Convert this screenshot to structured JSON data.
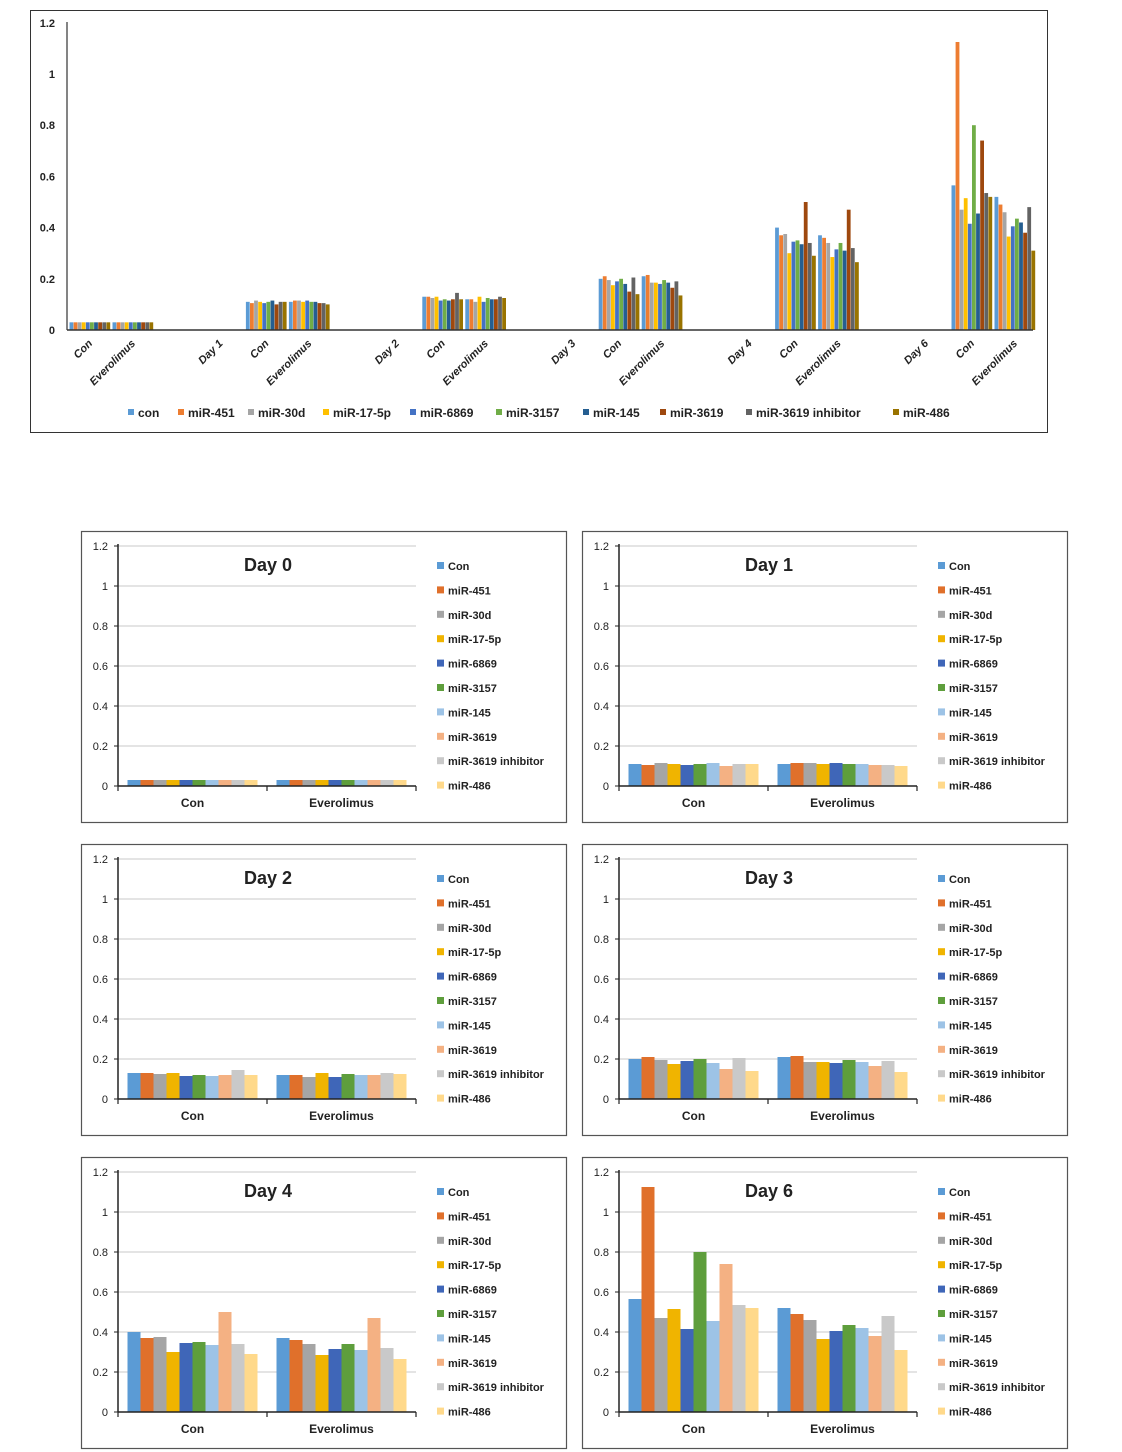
{
  "overview_legend_colors": [
    "#5B9BD5",
    "#ED7D31",
    "#A5A5A5",
    "#FFC000",
    "#4472C4",
    "#70AD47",
    "#255E91",
    "#9E480E",
    "#636363",
    "#997300"
  ],
  "panel_legend_colors": [
    "#5B9BD5",
    "#E0702B",
    "#A5A5A5",
    "#F0B400",
    "#3F66B8",
    "#5E9E3C",
    "#9DC3E6",
    "#F4B183",
    "#C9C9C9",
    "#FFD98B"
  ],
  "chart_data": [
    {
      "type": "bar",
      "yticks": [
        "0",
        "0.2",
        "0.4",
        "0.6",
        "0.8",
        "1",
        "1.2"
      ],
      "ylim": [
        0,
        1.2
      ],
      "grid": false,
      "legend": "bottom",
      "categories": [
        "Con",
        "Everolimus",
        "Day 1",
        "Con",
        "Everolimus",
        "Day 2",
        "Con",
        "Everolimus",
        "Day 3",
        "Con",
        "Everolimus",
        "Day 4",
        "Con",
        "Everolimus",
        "Day 6",
        "Con",
        "Everolimus"
      ],
      "series": [
        {
          "name": "con",
          "values": [
            0.03,
            0.03,
            null,
            0.11,
            0.11,
            null,
            0.13,
            0.12,
            null,
            0.2,
            0.21,
            null,
            0.4,
            0.37,
            null,
            0.565,
            0.52
          ]
        },
        {
          "name": "miR-451",
          "values": [
            0.03,
            0.03,
            null,
            0.105,
            0.115,
            null,
            0.13,
            0.12,
            null,
            0.21,
            0.215,
            null,
            0.37,
            0.36,
            null,
            1.125,
            0.49
          ]
        },
        {
          "name": "miR-30d",
          "values": [
            0.03,
            0.03,
            null,
            0.115,
            0.115,
            null,
            0.125,
            0.11,
            null,
            0.195,
            0.185,
            null,
            0.375,
            0.34,
            null,
            0.47,
            0.46
          ]
        },
        {
          "name": "miR-17-5p",
          "values": [
            0.03,
            0.03,
            null,
            0.11,
            0.11,
            null,
            0.13,
            0.13,
            null,
            0.175,
            0.185,
            null,
            0.3,
            0.285,
            null,
            0.515,
            0.365
          ]
        },
        {
          "name": "miR-6869",
          "values": [
            0.03,
            0.03,
            null,
            0.105,
            0.115,
            null,
            0.115,
            0.11,
            null,
            0.19,
            0.18,
            null,
            0.345,
            0.315,
            null,
            0.415,
            0.405
          ]
        },
        {
          "name": "miR-3157",
          "values": [
            0.03,
            0.03,
            null,
            0.11,
            0.11,
            null,
            0.12,
            0.125,
            null,
            0.2,
            0.195,
            null,
            0.35,
            0.34,
            null,
            0.8,
            0.435
          ]
        },
        {
          "name": "miR-145",
          "values": [
            0.03,
            0.03,
            null,
            0.115,
            0.11,
            null,
            0.115,
            0.12,
            null,
            0.18,
            0.185,
            null,
            0.335,
            0.31,
            null,
            0.455,
            0.42
          ]
        },
        {
          "name": "miR-3619",
          "values": [
            0.03,
            0.03,
            null,
            0.1,
            0.105,
            null,
            0.12,
            0.12,
            null,
            0.15,
            0.165,
            null,
            0.5,
            0.47,
            null,
            0.74,
            0.38
          ]
        },
        {
          "name": "miR-3619 inhibitor",
          "values": [
            0.03,
            0.03,
            null,
            0.11,
            0.105,
            null,
            0.145,
            0.13,
            null,
            0.205,
            0.19,
            null,
            0.34,
            0.32,
            null,
            0.535,
            0.48
          ]
        },
        {
          "name": "miR-486",
          "values": [
            0.03,
            0.03,
            null,
            0.11,
            0.1,
            null,
            0.12,
            0.125,
            null,
            0.14,
            0.135,
            null,
            0.29,
            0.265,
            null,
            0.52,
            0.31
          ]
        }
      ]
    },
    {
      "type": "bar",
      "title": "Day 0",
      "categories": [
        "Con",
        "Everolimus"
      ],
      "yticks": [
        "0",
        "0.2",
        "0.4",
        "0.6",
        "0.8",
        "1",
        "1.2"
      ],
      "ylim": [
        0,
        1.2
      ],
      "grid": true,
      "legend": "right",
      "series": [
        {
          "name": "Con",
          "values": [
            0.03,
            0.03
          ]
        },
        {
          "name": "miR-451",
          "values": [
            0.03,
            0.03
          ]
        },
        {
          "name": "miR-30d",
          "values": [
            0.03,
            0.03
          ]
        },
        {
          "name": "miR-17-5p",
          "values": [
            0.03,
            0.03
          ]
        },
        {
          "name": "miR-6869",
          "values": [
            0.03,
            0.03
          ]
        },
        {
          "name": "miR-3157",
          "values": [
            0.03,
            0.03
          ]
        },
        {
          "name": "miR-145",
          "values": [
            0.03,
            0.03
          ]
        },
        {
          "name": "miR-3619",
          "values": [
            0.03,
            0.03
          ]
        },
        {
          "name": "miR-3619 inhibitor",
          "values": [
            0.03,
            0.03
          ]
        },
        {
          "name": "miR-486",
          "values": [
            0.03,
            0.03
          ]
        }
      ]
    },
    {
      "type": "bar",
      "title": "Day 1",
      "categories": [
        "Con",
        "Everolimus"
      ],
      "yticks": [
        "0",
        "0.2",
        "0.4",
        "0.6",
        "0.8",
        "1",
        "1.2"
      ],
      "ylim": [
        0,
        1.2
      ],
      "grid": true,
      "legend": "right",
      "series": [
        {
          "name": "Con",
          "values": [
            0.11,
            0.11
          ]
        },
        {
          "name": "miR-451",
          "values": [
            0.105,
            0.115
          ]
        },
        {
          "name": "miR-30d",
          "values": [
            0.115,
            0.115
          ]
        },
        {
          "name": "miR-17-5p",
          "values": [
            0.11,
            0.11
          ]
        },
        {
          "name": "miR-6869",
          "values": [
            0.105,
            0.115
          ]
        },
        {
          "name": "miR-3157",
          "values": [
            0.11,
            0.11
          ]
        },
        {
          "name": "miR-145",
          "values": [
            0.115,
            0.11
          ]
        },
        {
          "name": "miR-3619",
          "values": [
            0.1,
            0.105
          ]
        },
        {
          "name": "miR-3619 inhibitor",
          "values": [
            0.11,
            0.105
          ]
        },
        {
          "name": "miR-486",
          "values": [
            0.11,
            0.1
          ]
        }
      ]
    },
    {
      "type": "bar",
      "title": "Day 2",
      "categories": [
        "Con",
        "Everolimus"
      ],
      "yticks": [
        "0",
        "0.2",
        "0.4",
        "0.6",
        "0.8",
        "1",
        "1.2"
      ],
      "ylim": [
        0,
        1.2
      ],
      "grid": true,
      "legend": "right",
      "series": [
        {
          "name": "Con",
          "values": [
            0.13,
            0.12
          ]
        },
        {
          "name": "miR-451",
          "values": [
            0.13,
            0.12
          ]
        },
        {
          "name": "miR-30d",
          "values": [
            0.125,
            0.11
          ]
        },
        {
          "name": "miR-17-5p",
          "values": [
            0.13,
            0.13
          ]
        },
        {
          "name": "miR-6869",
          "values": [
            0.115,
            0.11
          ]
        },
        {
          "name": "miR-3157",
          "values": [
            0.12,
            0.125
          ]
        },
        {
          "name": "miR-145",
          "values": [
            0.115,
            0.12
          ]
        },
        {
          "name": "miR-3619",
          "values": [
            0.12,
            0.12
          ]
        },
        {
          "name": "miR-3619 inhibitor",
          "values": [
            0.145,
            0.13
          ]
        },
        {
          "name": "miR-486",
          "values": [
            0.12,
            0.125
          ]
        }
      ]
    },
    {
      "type": "bar",
      "title": "Day 3",
      "categories": [
        "Con",
        "Everolimus"
      ],
      "yticks": [
        "0",
        "0.2",
        "0.4",
        "0.6",
        "0.8",
        "1",
        "1.2"
      ],
      "ylim": [
        0,
        1.2
      ],
      "grid": true,
      "legend": "right",
      "series": [
        {
          "name": "Con",
          "values": [
            0.2,
            0.21
          ]
        },
        {
          "name": "miR-451",
          "values": [
            0.21,
            0.215
          ]
        },
        {
          "name": "miR-30d",
          "values": [
            0.195,
            0.185
          ]
        },
        {
          "name": "miR-17-5p",
          "values": [
            0.175,
            0.185
          ]
        },
        {
          "name": "miR-6869",
          "values": [
            0.19,
            0.18
          ]
        },
        {
          "name": "miR-3157",
          "values": [
            0.2,
            0.195
          ]
        },
        {
          "name": "miR-145",
          "values": [
            0.18,
            0.185
          ]
        },
        {
          "name": "miR-3619",
          "values": [
            0.15,
            0.165
          ]
        },
        {
          "name": "miR-3619 inhibitor",
          "values": [
            0.205,
            0.19
          ]
        },
        {
          "name": "miR-486",
          "values": [
            0.14,
            0.135
          ]
        }
      ]
    },
    {
      "type": "bar",
      "title": "Day 4",
      "categories": [
        "Con",
        "Everolimus"
      ],
      "yticks": [
        "0",
        "0.2",
        "0.4",
        "0.6",
        "0.8",
        "1",
        "1.2"
      ],
      "ylim": [
        0,
        1.2
      ],
      "grid": true,
      "legend": "right",
      "series": [
        {
          "name": "Con",
          "values": [
            0.4,
            0.37
          ]
        },
        {
          "name": "miR-451",
          "values": [
            0.37,
            0.36
          ]
        },
        {
          "name": "miR-30d",
          "values": [
            0.375,
            0.34
          ]
        },
        {
          "name": "miR-17-5p",
          "values": [
            0.3,
            0.285
          ]
        },
        {
          "name": "miR-6869",
          "values": [
            0.345,
            0.315
          ]
        },
        {
          "name": "miR-3157",
          "values": [
            0.35,
            0.34
          ]
        },
        {
          "name": "miR-145",
          "values": [
            0.335,
            0.31
          ]
        },
        {
          "name": "miR-3619",
          "values": [
            0.5,
            0.47
          ]
        },
        {
          "name": "miR-3619 inhibitor",
          "values": [
            0.34,
            0.32
          ]
        },
        {
          "name": "miR-486",
          "values": [
            0.29,
            0.265
          ]
        }
      ]
    },
    {
      "type": "bar",
      "title": "Day 6",
      "categories": [
        "Con",
        "Everolimus"
      ],
      "yticks": [
        "0",
        "0.2",
        "0.4",
        "0.6",
        "0.8",
        "1",
        "1.2"
      ],
      "ylim": [
        0,
        1.2
      ],
      "grid": true,
      "legend": "right",
      "series": [
        {
          "name": "Con",
          "values": [
            0.565,
            0.52
          ]
        },
        {
          "name": "miR-451",
          "values": [
            1.125,
            0.49
          ]
        },
        {
          "name": "miR-30d",
          "values": [
            0.47,
            0.46
          ]
        },
        {
          "name": "miR-17-5p",
          "values": [
            0.515,
            0.365
          ]
        },
        {
          "name": "miR-6869",
          "values": [
            0.415,
            0.405
          ]
        },
        {
          "name": "miR-3157",
          "values": [
            0.8,
            0.435
          ]
        },
        {
          "name": "miR-145",
          "values": [
            0.455,
            0.42
          ]
        },
        {
          "name": "miR-3619",
          "values": [
            0.74,
            0.38
          ]
        },
        {
          "name": "miR-3619 inhibitor",
          "values": [
            0.535,
            0.48
          ]
        },
        {
          "name": "miR-486",
          "values": [
            0.52,
            0.31
          ]
        }
      ]
    }
  ]
}
